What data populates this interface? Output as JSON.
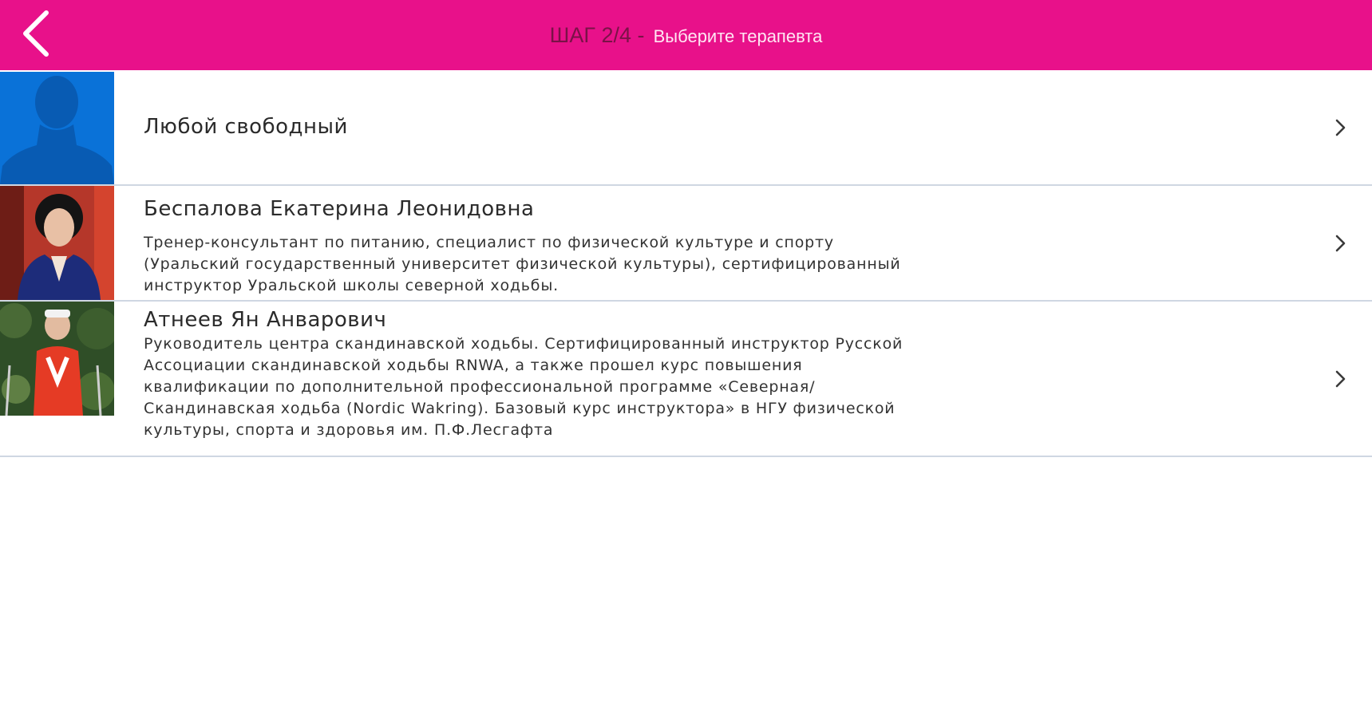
{
  "header": {
    "step": "ШАГ 2/4 -",
    "title": "Выберите терапевта",
    "back_icon": "chevron-left-icon",
    "background_color": "#e8118a"
  },
  "therapists": [
    {
      "name": "Любой свободный",
      "description": "",
      "avatar": "generic-person-placeholder"
    },
    {
      "name": "Беспалова Екатерина Леонидовна",
      "description": "Тренер-консультант по питанию, специалист по физической культуре и спорту (Уральский государственный университет физической культуры), сертифицированный инструктор Уральской школы северной ходьбы.",
      "avatar": "photo-woman"
    },
    {
      "name": "Атнеев Ян Анварович",
      "description": "Руководитель центра скандинавской ходьбы. Сертифицированный инструктор Русской Ассоциации скандинавской ходьбы RNWA, а также прошел курс повышения квалификации по дополнительной профессиональной программе «Северная/Скандинавская ходьба (Nordic Wakring). Базовый курс инструктора» в НГУ физической культуры, спорта и здоровья им. П.Ф.Лесгафта",
      "avatar": "photo-man"
    }
  ],
  "row_chevron_icon": "chevron-right-icon"
}
